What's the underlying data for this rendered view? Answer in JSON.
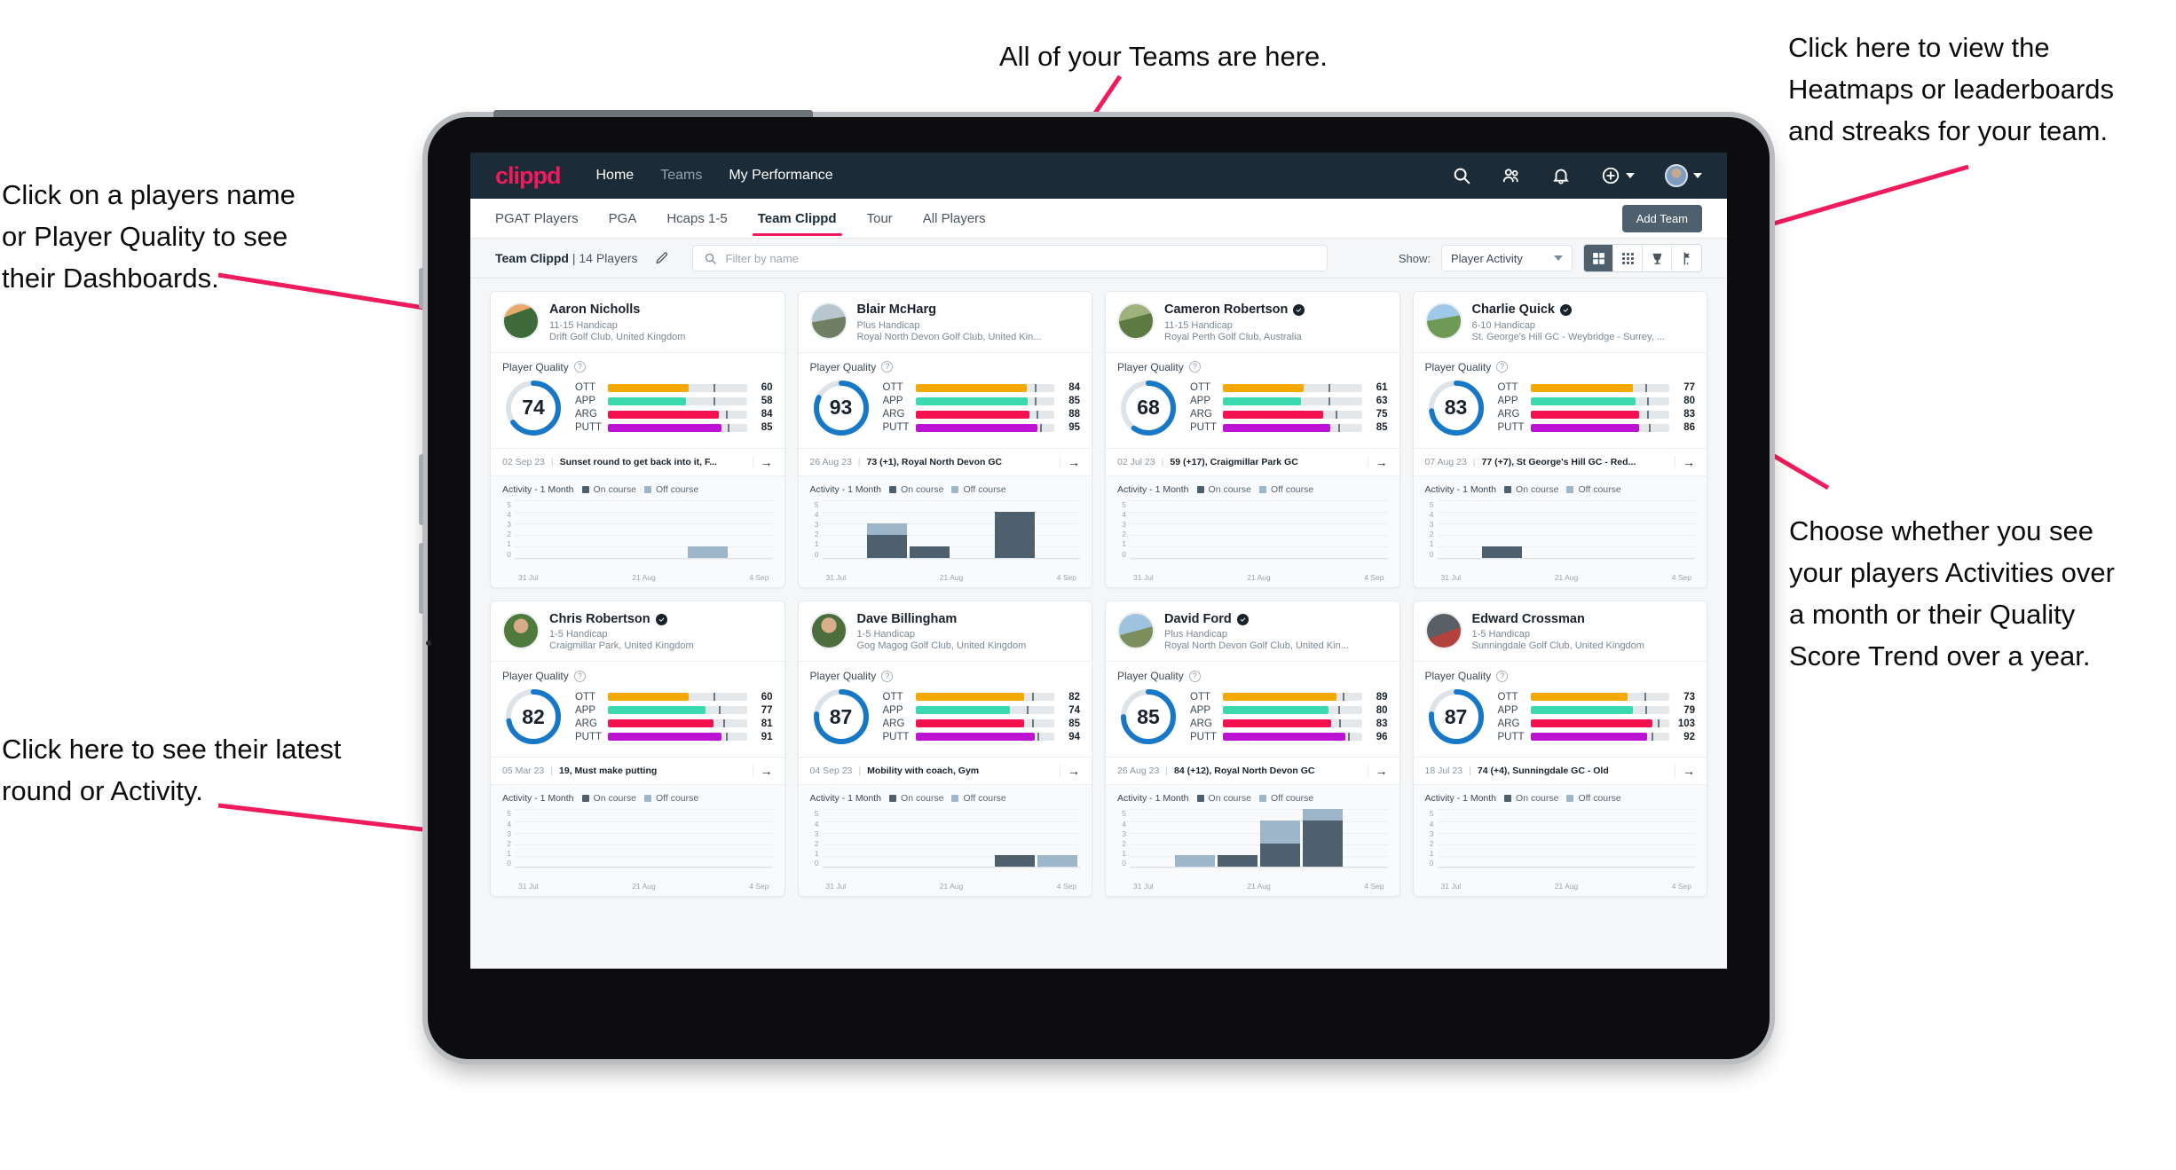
{
  "annotations": [
    {
      "id": "teams",
      "text": "All of your Teams are here."
    },
    {
      "id": "heatmap",
      "text": "Click here to view the\nHeatmaps or leaderboards\nand streaks for your team."
    },
    {
      "id": "names",
      "text": "Click on a players name\nor Player Quality to see\ntheir Dashboards."
    },
    {
      "id": "choose",
      "text": "Choose whether you see\nyour players Activities over\na month or their Quality\nScore Trend over a year."
    },
    {
      "id": "latest",
      "text": "Click here to see their latest\nround or Activity."
    }
  ],
  "navbar": {
    "logo": "clippd",
    "links": [
      {
        "label": "Home",
        "active": true
      },
      {
        "label": "Teams",
        "active": false
      },
      {
        "label": "My Performance",
        "active": true
      }
    ],
    "icons": [
      "search-icon",
      "people-icon",
      "bell-icon",
      "add-circle-icon",
      "avatar"
    ]
  },
  "tabs": [
    {
      "label": "PGAT Players",
      "active": false
    },
    {
      "label": "PGA",
      "active": false
    },
    {
      "label": "Hcaps 1-5",
      "active": false
    },
    {
      "label": "Team Clippd",
      "active": true
    },
    {
      "label": "Tour",
      "active": false
    },
    {
      "label": "All Players",
      "active": false
    }
  ],
  "add_team_label": "Add Team",
  "toolbar": {
    "team_name": "Team Clippd",
    "team_count": "14 Players",
    "separator": " | ",
    "search_placeholder": "Filter by name",
    "show_label": "Show:",
    "show_value": "Player Activity",
    "view_buttons": [
      "grid-large-icon",
      "grid-small-icon",
      "trophy-icon",
      "flag-icon"
    ]
  },
  "card_labels": {
    "player_quality": "Player Quality",
    "activity": "Activity - 1 Month",
    "on_course": "On course",
    "off_course": "Off course",
    "metrics": [
      "OTT",
      "APP",
      "ARG",
      "PUTT"
    ],
    "x_ticks": [
      "31 Jul",
      "21 Aug",
      "4 Sep"
    ],
    "y_ticks": [
      "5",
      "4",
      "3",
      "2",
      "1",
      "0"
    ]
  },
  "colors": {
    "accent_pink": "#ef1b5c",
    "navbar": "#1b2b38",
    "ring": "#1878c8",
    "ring_track": "#dde3e8",
    "ott": "#f5a800",
    "app": "#3ad9b0",
    "arg": "#f5114f",
    "putt": "#bb12d4",
    "on_course": "#4e606e",
    "off_course": "#9eb6ca"
  },
  "players": [
    {
      "name": "Aaron Nicholls",
      "verified": false,
      "handicap": "11-15 Handicap",
      "club": "Drift Golf Club, United Kingdom",
      "quality": 74,
      "metrics": [
        {
          "label": "OTT",
          "value": 60,
          "fill": 58,
          "tick": 76
        },
        {
          "label": "APP",
          "value": 58,
          "fill": 56,
          "tick": 76
        },
        {
          "label": "ARG",
          "value": 84,
          "fill": 80,
          "tick": 85
        },
        {
          "label": "PUTT",
          "value": 85,
          "fill": 82,
          "tick": 86
        }
      ],
      "latest_date": "02 Sep 23",
      "latest_text": "Sunset round to get back into it, F...",
      "activity": [
        {
          "on": 0,
          "off": 0
        },
        {
          "on": 0,
          "off": 0
        },
        {
          "on": 0,
          "off": 0
        },
        {
          "on": 0,
          "off": 0
        },
        {
          "on": 0,
          "off": 1
        },
        {
          "on": 0,
          "off": 0
        }
      ]
    },
    {
      "name": "Blair McHarg",
      "verified": false,
      "handicap": "Plus Handicap",
      "club": "Royal North Devon Golf Club, United Kin...",
      "quality": 93,
      "metrics": [
        {
          "label": "OTT",
          "value": 84,
          "fill": 80,
          "tick": 86
        },
        {
          "label": "APP",
          "value": 85,
          "fill": 81,
          "tick": 86
        },
        {
          "label": "ARG",
          "value": 88,
          "fill": 82,
          "tick": 87
        },
        {
          "label": "PUTT",
          "value": 95,
          "fill": 88,
          "tick": 90
        }
      ],
      "latest_date": "26 Aug 23",
      "latest_text": "73 (+1), Royal North Devon GC",
      "activity": [
        {
          "on": 0,
          "off": 0
        },
        {
          "on": 2,
          "off": 1
        },
        {
          "on": 1,
          "off": 0
        },
        {
          "on": 0,
          "off": 0
        },
        {
          "on": 4,
          "off": 0
        },
        {
          "on": 0,
          "off": 0
        }
      ]
    },
    {
      "name": "Cameron Robertson",
      "verified": true,
      "handicap": "11-15 Handicap",
      "club": "Royal Perth Golf Club, Australia",
      "quality": 68,
      "metrics": [
        {
          "label": "OTT",
          "value": 61,
          "fill": 58,
          "tick": 76
        },
        {
          "label": "APP",
          "value": 63,
          "fill": 56,
          "tick": 76
        },
        {
          "label": "ARG",
          "value": 75,
          "fill": 72,
          "tick": 81
        },
        {
          "label": "PUTT",
          "value": 85,
          "fill": 77,
          "tick": 83
        }
      ],
      "latest_date": "02 Jul 23",
      "latest_text": "59 (+17), Craigmillar Park GC",
      "activity": [
        {
          "on": 0,
          "off": 0
        },
        {
          "on": 0,
          "off": 0
        },
        {
          "on": 0,
          "off": 0
        },
        {
          "on": 0,
          "off": 0
        },
        {
          "on": 0,
          "off": 0
        },
        {
          "on": 0,
          "off": 0
        }
      ]
    },
    {
      "name": "Charlie Quick",
      "verified": true,
      "handicap": "6-10 Handicap",
      "club": "St. George's Hill GC - Weybridge - Surrey, ...",
      "quality": 83,
      "metrics": [
        {
          "label": "OTT",
          "value": 77,
          "fill": 74,
          "tick": 83
        },
        {
          "label": "APP",
          "value": 80,
          "fill": 76,
          "tick": 84
        },
        {
          "label": "ARG",
          "value": 83,
          "fill": 78,
          "tick": 84
        },
        {
          "label": "PUTT",
          "value": 86,
          "fill": 78,
          "tick": 85
        }
      ],
      "latest_date": "07 Aug 23",
      "latest_text": "77 (+7), St George's Hill GC - Red...",
      "activity": [
        {
          "on": 0,
          "off": 0
        },
        {
          "on": 1,
          "off": 0
        },
        {
          "on": 0,
          "off": 0
        },
        {
          "on": 0,
          "off": 0
        },
        {
          "on": 0,
          "off": 0
        },
        {
          "on": 0,
          "off": 0
        }
      ]
    },
    {
      "name": "Chris Robertson",
      "verified": true,
      "handicap": "1-5 Handicap",
      "club": "Craigmillar Park, United Kingdom",
      "quality": 82,
      "metrics": [
        {
          "label": "OTT",
          "value": 60,
          "fill": 58,
          "tick": 76
        },
        {
          "label": "APP",
          "value": 77,
          "fill": 70,
          "tick": 80
        },
        {
          "label": "ARG",
          "value": 81,
          "fill": 76,
          "tick": 83
        },
        {
          "label": "PUTT",
          "value": 91,
          "fill": 82,
          "tick": 85
        }
      ],
      "latest_date": "05 Mar 23",
      "latest_text": "19, Must make putting",
      "activity": [
        {
          "on": 0,
          "off": 0
        },
        {
          "on": 0,
          "off": 0
        },
        {
          "on": 0,
          "off": 0
        },
        {
          "on": 0,
          "off": 0
        },
        {
          "on": 0,
          "off": 0
        },
        {
          "on": 0,
          "off": 0
        }
      ]
    },
    {
      "name": "Dave Billingham",
      "verified": false,
      "handicap": "1-5 Handicap",
      "club": "Gog Magog Golf Club, United Kingdom",
      "quality": 87,
      "metrics": [
        {
          "label": "OTT",
          "value": 82,
          "fill": 78,
          "tick": 84
        },
        {
          "label": "APP",
          "value": 74,
          "fill": 68,
          "tick": 80
        },
        {
          "label": "ARG",
          "value": 85,
          "fill": 78,
          "tick": 84
        },
        {
          "label": "PUTT",
          "value": 94,
          "fill": 86,
          "tick": 88
        }
      ],
      "latest_date": "04 Sep 23",
      "latest_text": "Mobility with coach, Gym",
      "activity": [
        {
          "on": 0,
          "off": 0
        },
        {
          "on": 0,
          "off": 0
        },
        {
          "on": 0,
          "off": 0
        },
        {
          "on": 0,
          "off": 0
        },
        {
          "on": 1,
          "off": 0
        },
        {
          "on": 0,
          "off": 1
        }
      ]
    },
    {
      "name": "David Ford",
      "verified": true,
      "handicap": "Plus Handicap",
      "club": "Royal North Devon Golf Club, United Kin...",
      "quality": 85,
      "metrics": [
        {
          "label": "OTT",
          "value": 89,
          "fill": 82,
          "tick": 86
        },
        {
          "label": "APP",
          "value": 80,
          "fill": 76,
          "tick": 83
        },
        {
          "label": "ARG",
          "value": 83,
          "fill": 78,
          "tick": 84
        },
        {
          "label": "PUTT",
          "value": 96,
          "fill": 88,
          "tick": 90
        }
      ],
      "latest_date": "26 Aug 23",
      "latest_text": "84 (+12), Royal North Devon GC",
      "activity": [
        {
          "on": 0,
          "off": 0
        },
        {
          "on": 0,
          "off": 1
        },
        {
          "on": 1,
          "off": 0
        },
        {
          "on": 2,
          "off": 2
        },
        {
          "on": 4,
          "off": 1
        },
        {
          "on": 0,
          "off": 0
        }
      ]
    },
    {
      "name": "Edward Crossman",
      "verified": false,
      "handicap": "1-5 Handicap",
      "club": "Sunningdale Golf Club, United Kingdom",
      "quality": 87,
      "metrics": [
        {
          "label": "OTT",
          "value": 73,
          "fill": 70,
          "tick": 82
        },
        {
          "label": "APP",
          "value": 79,
          "fill": 74,
          "tick": 83
        },
        {
          "label": "ARG",
          "value": 103,
          "fill": 88,
          "tick": 92
        },
        {
          "label": "PUTT",
          "value": 92,
          "fill": 84,
          "tick": 87
        }
      ],
      "latest_date": "18 Jul 23",
      "latest_text": "74 (+4), Sunningdale GC - Old",
      "activity": [
        {
          "on": 0,
          "off": 0
        },
        {
          "on": 0,
          "off": 0
        },
        {
          "on": 0,
          "off": 0
        },
        {
          "on": 0,
          "off": 0
        },
        {
          "on": 0,
          "off": 0
        },
        {
          "on": 0,
          "off": 0
        }
      ]
    }
  ]
}
